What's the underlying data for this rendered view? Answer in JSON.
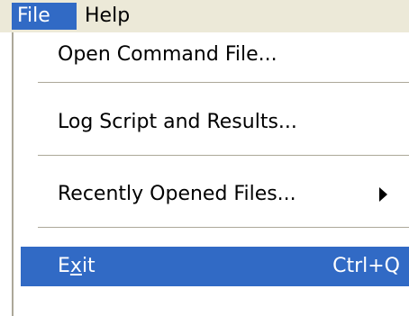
{
  "menubar": {
    "items": [
      {
        "label": "File"
      },
      {
        "label": "Help"
      }
    ]
  },
  "file_menu": {
    "items": [
      {
        "label": "Open Command File..."
      },
      {
        "label": "Log Script and Results..."
      },
      {
        "label": "Recently Opened Files..."
      },
      {
        "label_prefix": "E",
        "label_mnemonic": "x",
        "label_suffix": "it",
        "shortcut": "Ctrl+Q"
      }
    ],
    "submenu_icon": "triangle-right-icon"
  },
  "colors": {
    "highlight": "#316ac5",
    "menubar_bg": "#ece9d8",
    "separator": "#aca899"
  }
}
